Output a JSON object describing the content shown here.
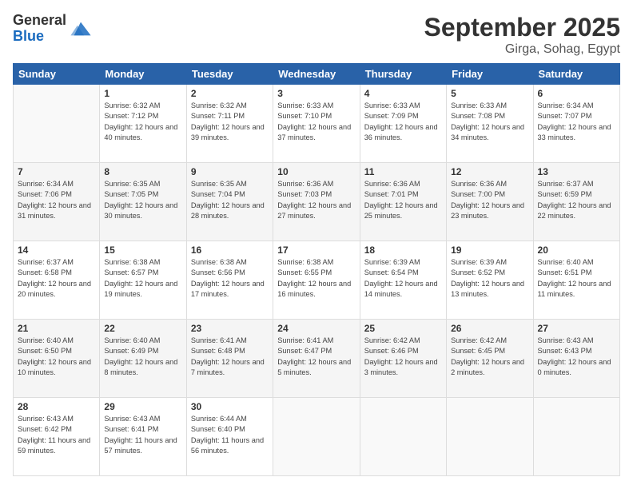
{
  "header": {
    "logo_general": "General",
    "logo_blue": "Blue",
    "title": "September 2025",
    "subtitle": "Girga, Sohag, Egypt"
  },
  "weekdays": [
    "Sunday",
    "Monday",
    "Tuesday",
    "Wednesday",
    "Thursday",
    "Friday",
    "Saturday"
  ],
  "weeks": [
    [
      {
        "day": "",
        "empty": true
      },
      {
        "day": "1",
        "sunrise": "Sunrise: 6:32 AM",
        "sunset": "Sunset: 7:12 PM",
        "daylight": "Daylight: 12 hours and 40 minutes."
      },
      {
        "day": "2",
        "sunrise": "Sunrise: 6:32 AM",
        "sunset": "Sunset: 7:11 PM",
        "daylight": "Daylight: 12 hours and 39 minutes."
      },
      {
        "day": "3",
        "sunrise": "Sunrise: 6:33 AM",
        "sunset": "Sunset: 7:10 PM",
        "daylight": "Daylight: 12 hours and 37 minutes."
      },
      {
        "day": "4",
        "sunrise": "Sunrise: 6:33 AM",
        "sunset": "Sunset: 7:09 PM",
        "daylight": "Daylight: 12 hours and 36 minutes."
      },
      {
        "day": "5",
        "sunrise": "Sunrise: 6:33 AM",
        "sunset": "Sunset: 7:08 PM",
        "daylight": "Daylight: 12 hours and 34 minutes."
      },
      {
        "day": "6",
        "sunrise": "Sunrise: 6:34 AM",
        "sunset": "Sunset: 7:07 PM",
        "daylight": "Daylight: 12 hours and 33 minutes."
      }
    ],
    [
      {
        "day": "7",
        "sunrise": "Sunrise: 6:34 AM",
        "sunset": "Sunset: 7:06 PM",
        "daylight": "Daylight: 12 hours and 31 minutes."
      },
      {
        "day": "8",
        "sunrise": "Sunrise: 6:35 AM",
        "sunset": "Sunset: 7:05 PM",
        "daylight": "Daylight: 12 hours and 30 minutes."
      },
      {
        "day": "9",
        "sunrise": "Sunrise: 6:35 AM",
        "sunset": "Sunset: 7:04 PM",
        "daylight": "Daylight: 12 hours and 28 minutes."
      },
      {
        "day": "10",
        "sunrise": "Sunrise: 6:36 AM",
        "sunset": "Sunset: 7:03 PM",
        "daylight": "Daylight: 12 hours and 27 minutes."
      },
      {
        "day": "11",
        "sunrise": "Sunrise: 6:36 AM",
        "sunset": "Sunset: 7:01 PM",
        "daylight": "Daylight: 12 hours and 25 minutes."
      },
      {
        "day": "12",
        "sunrise": "Sunrise: 6:36 AM",
        "sunset": "Sunset: 7:00 PM",
        "daylight": "Daylight: 12 hours and 23 minutes."
      },
      {
        "day": "13",
        "sunrise": "Sunrise: 6:37 AM",
        "sunset": "Sunset: 6:59 PM",
        "daylight": "Daylight: 12 hours and 22 minutes."
      }
    ],
    [
      {
        "day": "14",
        "sunrise": "Sunrise: 6:37 AM",
        "sunset": "Sunset: 6:58 PM",
        "daylight": "Daylight: 12 hours and 20 minutes."
      },
      {
        "day": "15",
        "sunrise": "Sunrise: 6:38 AM",
        "sunset": "Sunset: 6:57 PM",
        "daylight": "Daylight: 12 hours and 19 minutes."
      },
      {
        "day": "16",
        "sunrise": "Sunrise: 6:38 AM",
        "sunset": "Sunset: 6:56 PM",
        "daylight": "Daylight: 12 hours and 17 minutes."
      },
      {
        "day": "17",
        "sunrise": "Sunrise: 6:38 AM",
        "sunset": "Sunset: 6:55 PM",
        "daylight": "Daylight: 12 hours and 16 minutes."
      },
      {
        "day": "18",
        "sunrise": "Sunrise: 6:39 AM",
        "sunset": "Sunset: 6:54 PM",
        "daylight": "Daylight: 12 hours and 14 minutes."
      },
      {
        "day": "19",
        "sunrise": "Sunrise: 6:39 AM",
        "sunset": "Sunset: 6:52 PM",
        "daylight": "Daylight: 12 hours and 13 minutes."
      },
      {
        "day": "20",
        "sunrise": "Sunrise: 6:40 AM",
        "sunset": "Sunset: 6:51 PM",
        "daylight": "Daylight: 12 hours and 11 minutes."
      }
    ],
    [
      {
        "day": "21",
        "sunrise": "Sunrise: 6:40 AM",
        "sunset": "Sunset: 6:50 PM",
        "daylight": "Daylight: 12 hours and 10 minutes."
      },
      {
        "day": "22",
        "sunrise": "Sunrise: 6:40 AM",
        "sunset": "Sunset: 6:49 PM",
        "daylight": "Daylight: 12 hours and 8 minutes."
      },
      {
        "day": "23",
        "sunrise": "Sunrise: 6:41 AM",
        "sunset": "Sunset: 6:48 PM",
        "daylight": "Daylight: 12 hours and 7 minutes."
      },
      {
        "day": "24",
        "sunrise": "Sunrise: 6:41 AM",
        "sunset": "Sunset: 6:47 PM",
        "daylight": "Daylight: 12 hours and 5 minutes."
      },
      {
        "day": "25",
        "sunrise": "Sunrise: 6:42 AM",
        "sunset": "Sunset: 6:46 PM",
        "daylight": "Daylight: 12 hours and 3 minutes."
      },
      {
        "day": "26",
        "sunrise": "Sunrise: 6:42 AM",
        "sunset": "Sunset: 6:45 PM",
        "daylight": "Daylight: 12 hours and 2 minutes."
      },
      {
        "day": "27",
        "sunrise": "Sunrise: 6:43 AM",
        "sunset": "Sunset: 6:43 PM",
        "daylight": "Daylight: 12 hours and 0 minutes."
      }
    ],
    [
      {
        "day": "28",
        "sunrise": "Sunrise: 6:43 AM",
        "sunset": "Sunset: 6:42 PM",
        "daylight": "Daylight: 11 hours and 59 minutes."
      },
      {
        "day": "29",
        "sunrise": "Sunrise: 6:43 AM",
        "sunset": "Sunset: 6:41 PM",
        "daylight": "Daylight: 11 hours and 57 minutes."
      },
      {
        "day": "30",
        "sunrise": "Sunrise: 6:44 AM",
        "sunset": "Sunset: 6:40 PM",
        "daylight": "Daylight: 11 hours and 56 minutes."
      },
      {
        "day": "",
        "empty": true
      },
      {
        "day": "",
        "empty": true
      },
      {
        "day": "",
        "empty": true
      },
      {
        "day": "",
        "empty": true
      }
    ]
  ]
}
